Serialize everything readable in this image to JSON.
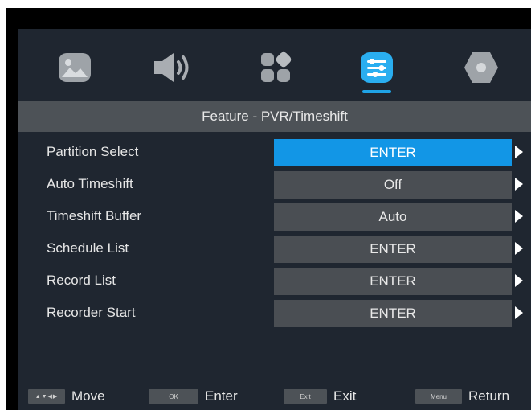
{
  "tabs": [
    {
      "icon": "picture-icon",
      "active": false
    },
    {
      "icon": "sound-icon",
      "active": false
    },
    {
      "icon": "channel-icon",
      "active": false
    },
    {
      "icon": "feature-icon",
      "active": true
    },
    {
      "icon": "setup-icon",
      "active": false
    }
  ],
  "header": {
    "title": "Feature - PVR/Timeshift"
  },
  "rows": [
    {
      "label": "Partition Select",
      "value": "ENTER",
      "selected": true
    },
    {
      "label": "Auto Timeshift",
      "value": "Off",
      "selected": false
    },
    {
      "label": "Timeshift Buffer",
      "value": "Auto",
      "selected": false
    },
    {
      "label": "Schedule List",
      "value": "ENTER",
      "selected": false
    },
    {
      "label": "Record List",
      "value": "ENTER",
      "selected": false
    },
    {
      "label": "Recorder Start",
      "value": "ENTER",
      "selected": false
    }
  ],
  "footer": {
    "move": {
      "key": "▲▼◀▶",
      "label": "Move"
    },
    "enter": {
      "key": "OK",
      "label": "Enter"
    },
    "exit": {
      "key": "Exit",
      "label": "Exit"
    },
    "return": {
      "key": "Menu",
      "label": "Return"
    }
  },
  "colors": {
    "accent": "#1296e6",
    "panel": "#1f2630",
    "row_bg": "#4a4e53",
    "header_bg": "#4d5257"
  }
}
